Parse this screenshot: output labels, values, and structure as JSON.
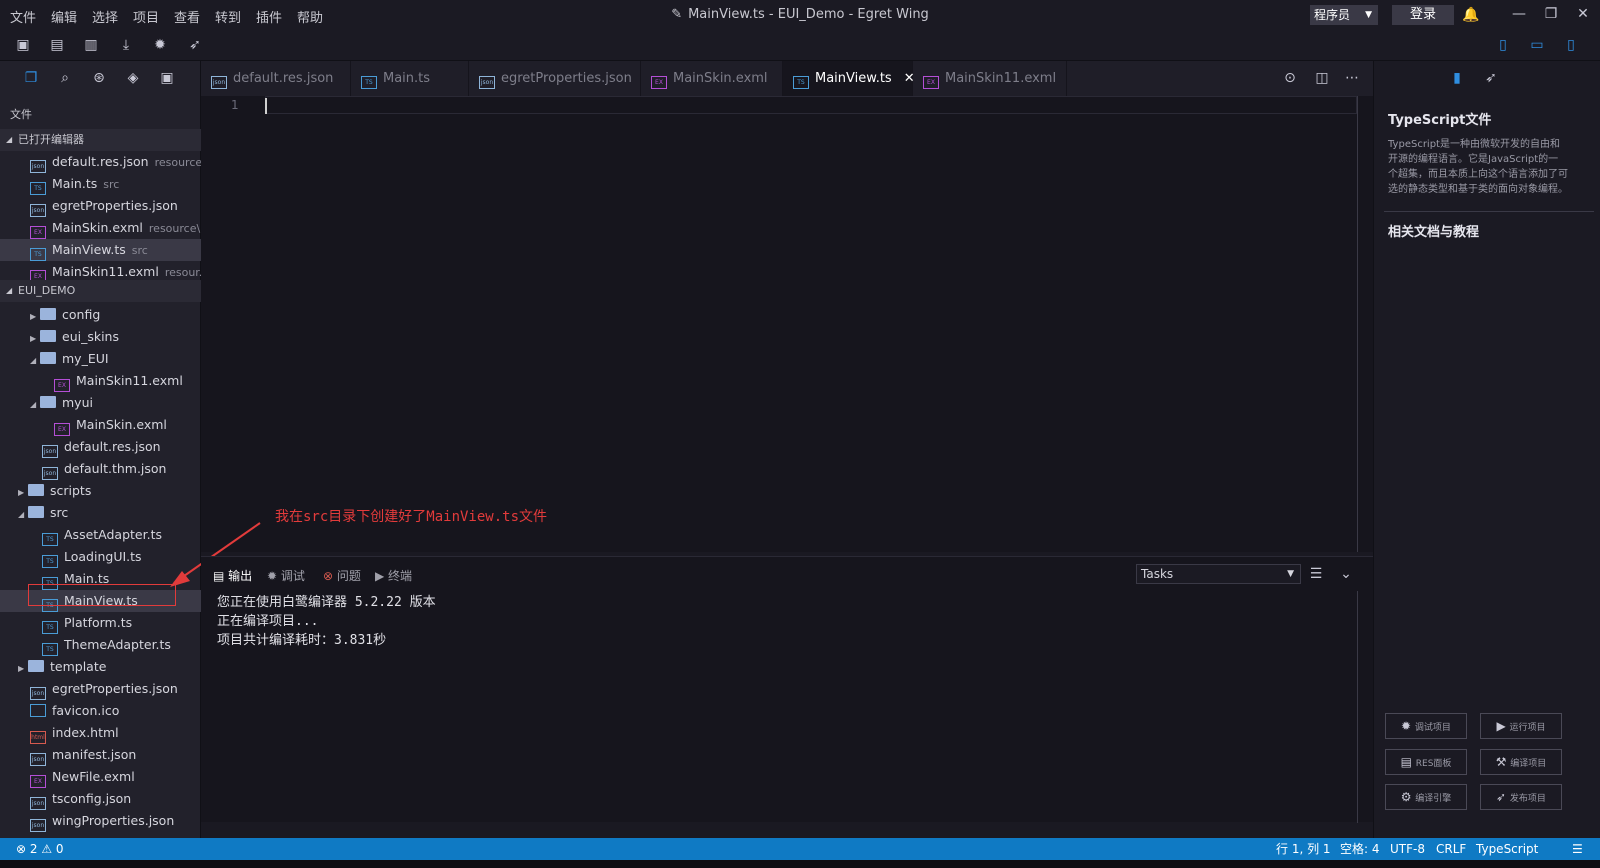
{
  "menu": [
    "文件",
    "编辑",
    "选择",
    "项目",
    "查看",
    "转到",
    "插件",
    "帮助"
  ],
  "window_title": "MainView.ts - EUI_Demo - Egret Wing",
  "role": "程序员",
  "login": "登录",
  "sidebar": {
    "files_label": "文件",
    "open_editors_label": "已打开编辑器",
    "open_editors": [
      {
        "name": "default.res.json",
        "hint": "resource",
        "type": "json"
      },
      {
        "name": "Main.ts",
        "hint": "src",
        "type": "ts"
      },
      {
        "name": "egretProperties.json",
        "hint": "",
        "type": "json"
      },
      {
        "name": "MainSkin.exml",
        "hint": "resource\\...",
        "type": "exml"
      },
      {
        "name": "MainView.ts",
        "hint": "src",
        "type": "ts"
      },
      {
        "name": "MainSkin11.exml",
        "hint": "resour...",
        "type": "exml"
      }
    ],
    "project_label": "EUI_DEMO",
    "tree": [
      {
        "name": "config",
        "kind": "folder"
      },
      {
        "name": "eui_skins",
        "kind": "folder"
      },
      {
        "name": "my_EUI",
        "kind": "folder"
      },
      {
        "name": "MainSkin11.exml",
        "kind": "exml"
      },
      {
        "name": "myui",
        "kind": "folder"
      },
      {
        "name": "MainSkin.exml",
        "kind": "exml"
      },
      {
        "name": "default.res.json",
        "kind": "json"
      },
      {
        "name": "default.thm.json",
        "kind": "json"
      },
      {
        "name": "scripts",
        "kind": "folder"
      },
      {
        "name": "src",
        "kind": "folder"
      },
      {
        "name": "AssetAdapter.ts",
        "kind": "ts"
      },
      {
        "name": "LoadingUI.ts",
        "kind": "ts"
      },
      {
        "name": "Main.ts",
        "kind": "ts"
      },
      {
        "name": "MainView.ts",
        "kind": "ts"
      },
      {
        "name": "Platform.ts",
        "kind": "ts"
      },
      {
        "name": "ThemeAdapter.ts",
        "kind": "ts"
      },
      {
        "name": "template",
        "kind": "folder"
      },
      {
        "name": "egretProperties.json",
        "kind": "json"
      },
      {
        "name": "favicon.ico",
        "kind": "ts"
      },
      {
        "name": "index.html",
        "kind": "html"
      },
      {
        "name": "manifest.json",
        "kind": "json"
      },
      {
        "name": "NewFile.exml",
        "kind": "exml"
      },
      {
        "name": "tsconfig.json",
        "kind": "json"
      },
      {
        "name": "wingProperties.json",
        "kind": "json"
      }
    ]
  },
  "tabs": [
    {
      "label": "default.res.json",
      "type": "json"
    },
    {
      "label": "Main.ts",
      "type": "ts"
    },
    {
      "label": "egretProperties.json",
      "type": "json"
    },
    {
      "label": "MainSkin.exml",
      "type": "exml"
    },
    {
      "label": "MainView.ts",
      "type": "ts"
    },
    {
      "label": "MainSkin11.exml",
      "type": "exml"
    }
  ],
  "tab_close": "✕",
  "editor": {
    "line_number": "1"
  },
  "annotation": "我在src目录下创建好了MainView.ts文件",
  "panel": {
    "tabs": [
      "输出",
      "调试",
      "问题",
      "终端"
    ],
    "tasks": "Tasks",
    "output": [
      "您正在使用白鹭编译器 5.2.22 版本",
      "正在编译项目...",
      "项目共计编译耗时：3.831秒"
    ]
  },
  "right": {
    "title": "TypeScript文件",
    "desc": "TypeScript是一种由微软开发的自由和开源的编程语言。它是JavaScript的一个超集，而且本质上向这个语言添加了可选的静态类型和基于类的面向对象编程。",
    "related": "相关文档与教程",
    "buttons": [
      "调试项目",
      "运行项目",
      "RES面板",
      "编译项目",
      "编译引擎",
      "发布项目"
    ]
  },
  "status": {
    "errors": "2",
    "warnings": "0",
    "position": "行 1, 列 1",
    "spaces": "空格: 4",
    "encoding": "UTF-8",
    "eol": "CRLF",
    "language": "TypeScript"
  },
  "colors": {
    "accent": "#0f7ac4",
    "annotation": "#e23b3b"
  }
}
